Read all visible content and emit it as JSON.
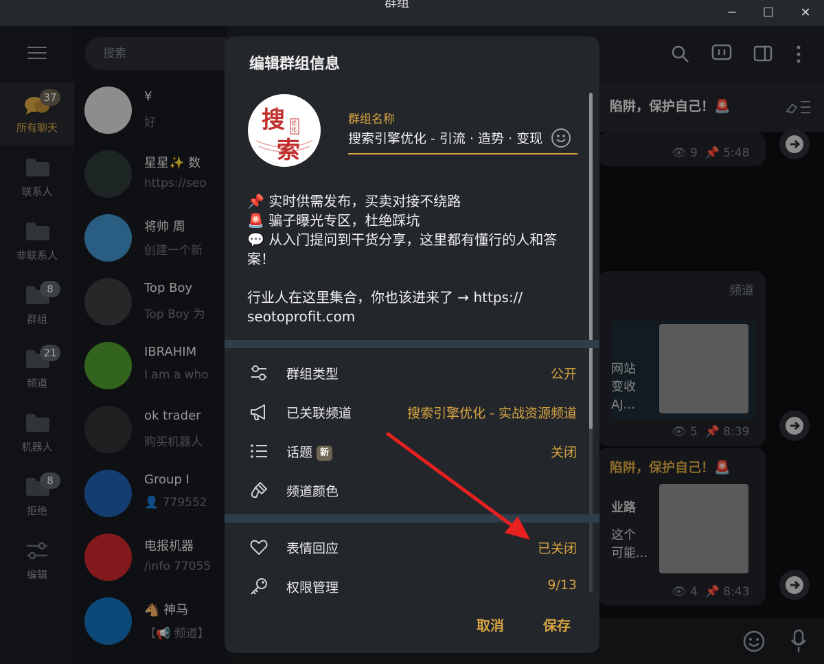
{
  "window": {
    "title": "群组",
    "minimize": "─",
    "maximize": "☐",
    "close": "✕"
  },
  "sidebar": {
    "folders": [
      {
        "label": "所有聊天",
        "badge": "37",
        "active": true
      },
      {
        "label": "联系人",
        "badge": ""
      },
      {
        "label": "非联系人",
        "badge": ""
      },
      {
        "label": "群组",
        "badge": "8"
      },
      {
        "label": "频道",
        "badge": "21"
      },
      {
        "label": "机器人",
        "badge": ""
      },
      {
        "label": "拒绝",
        "badge": "8"
      },
      {
        "label": "编辑",
        "badge": ""
      }
    ]
  },
  "search": {
    "placeholder": "搜索"
  },
  "chats": [
    {
      "name": "¥",
      "preview": "好",
      "avatar_color": "#d9d9d9"
    },
    {
      "name": "星星✨ 数",
      "preview": "https://seo",
      "avatar_color": "#2e3b3a"
    },
    {
      "name": "将帅 周",
      "preview": "创建一个新",
      "avatar_color": "#3f8fc8"
    },
    {
      "name": "Top Boy",
      "preview": "Top Boy 为",
      "avatar_color": "#3a3d40"
    },
    {
      "name": "IBRAHIM",
      "preview": "I am a who",
      "avatar_color": "#4f9a2e"
    },
    {
      "name": "ok trader",
      "preview": "购买机器人",
      "avatar_color": "#2f3133"
    },
    {
      "name": "Group I",
      "preview": "👤 779552",
      "avatar_color": "#1f5fae"
    },
    {
      "name": "电报机器",
      "preview": "/info 77055",
      "avatar_color": "#c8272c"
    },
    {
      "name": "🐴 神马",
      "preview": "【📢 频道】",
      "avatar_color": "#1470b8"
    }
  ],
  "background_chat": {
    "pinned_text": "陷阱，保护自己！🚨",
    "messages": [
      {
        "views": "9",
        "time": "5:48"
      },
      {
        "label": "频道",
        "snippet1": "网站",
        "snippet2": "变收",
        "snippet3": "AJ...",
        "views": "5",
        "time": "8:39"
      },
      {
        "title": "陷阱，保护自己！🚨",
        "snippet1": "业路",
        "snippet2": "这个",
        "snippet3": "可能...",
        "views": "4",
        "time": "8:43"
      }
    ]
  },
  "dialog": {
    "title": "编辑群组信息",
    "logo_text_1": "搜",
    "logo_text_2": "索",
    "logo_stamp": "优化",
    "name_label": "群组名称",
    "name_value": "搜索引擎优化 - 引流 · 造势 · 变现",
    "description_lines": [
      "📌 实时供需发布，买卖对接不绕路",
      "🚨 骗子曝光专区，杜绝踩坑",
      "💬 从入门提问到干货分享，这里都有懂行的人和答",
      "案！",
      "",
      "行业人在这里集合，你也该进来了 → https://",
      "seotoprofit.com"
    ],
    "settings": [
      {
        "label": "群组类型",
        "value": "公开",
        "icon": "sliders-icon"
      },
      {
        "label": "已关联频道",
        "value": "搜索引擎优化 - 实战资源频道",
        "icon": "megaphone-icon"
      },
      {
        "label": "话题",
        "tag": "新",
        "value": "关闭",
        "icon": "list-icon"
      },
      {
        "label": "频道颜色",
        "value": "",
        "icon": "brush-icon"
      }
    ],
    "settings2": [
      {
        "label": "表情回应",
        "value": "已关闭",
        "icon": "heart-icon"
      },
      {
        "label": "权限管理",
        "value": "9/13",
        "icon": "key-icon"
      }
    ],
    "cancel": "取消",
    "save": "保存"
  },
  "colors": {
    "accent": "#d7a542",
    "annotation_arrow": "#e8201f",
    "dialog_bg": "#23262b"
  }
}
